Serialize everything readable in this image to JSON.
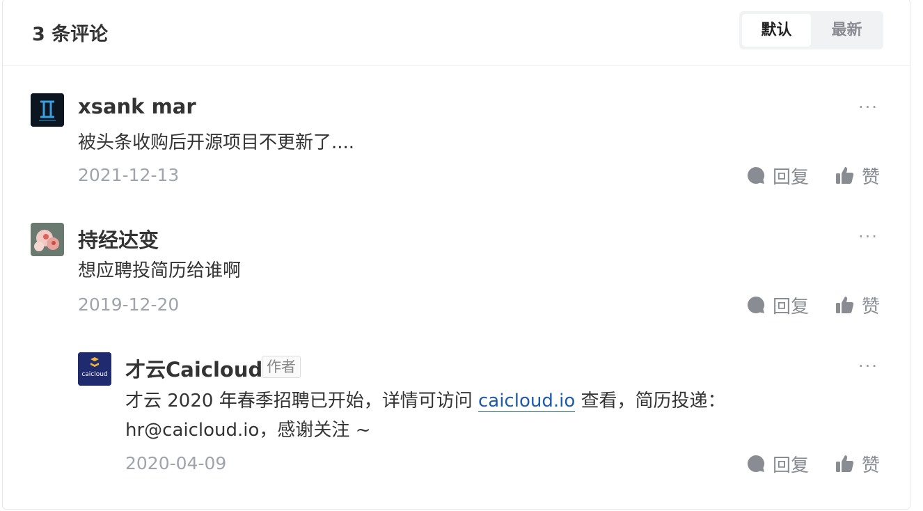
{
  "header": {
    "title": "3 条评论",
    "sort": {
      "default_label": "默认",
      "latest_label": "最新"
    }
  },
  "comments": [
    {
      "name": "xsank mar",
      "content": "被头条收购后开源项目不更新了....",
      "date": "2021-12-13",
      "reply_label": "回复",
      "like_label": "赞",
      "more_label": "···"
    },
    {
      "name": "持经达变",
      "content": "想应聘投简历给谁啊",
      "date": "2019-12-20",
      "reply_label": "回复",
      "like_label": "赞",
      "more_label": "···",
      "reply": {
        "name": "才云Caicloud",
        "badge": "作者",
        "content_before": "才云 2020 年春季招聘已开始，详情可访问 ",
        "link": "caicloud.io",
        "content_after_line1": " 查看，简历投递：",
        "content_line2": "hr@caicloud.io，感谢关注 ~",
        "date": "2020-04-09",
        "reply_label": "回复",
        "like_label": "赞",
        "more_label": "···",
        "avatar_logo_text": "caicloud"
      }
    }
  ],
  "colors": {
    "accent_link": "#1e5aa8",
    "muted": "#8a8c94"
  }
}
